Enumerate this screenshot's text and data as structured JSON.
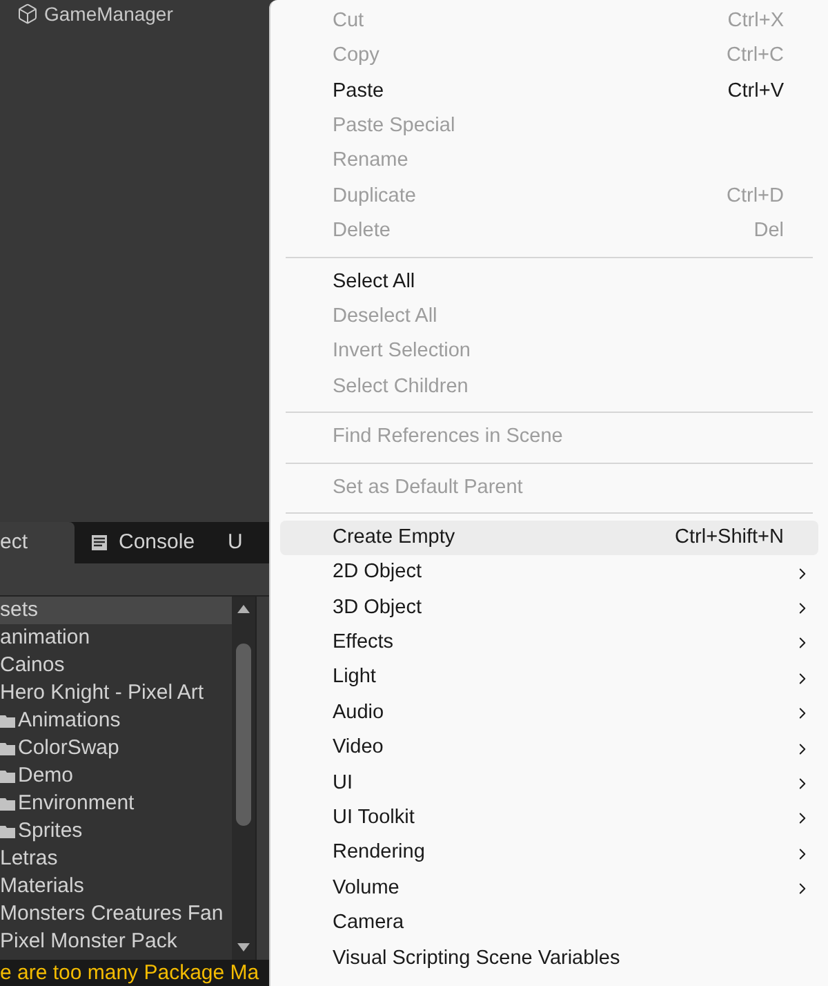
{
  "hierarchy": {
    "items": [
      {
        "label": "GameManager"
      }
    ]
  },
  "panel_tabs": [
    {
      "label": "ect",
      "selected": true,
      "kind": "plain"
    },
    {
      "label": "Console",
      "selected": false,
      "kind": "console"
    },
    {
      "label": "U",
      "selected": false,
      "kind": "plain"
    }
  ],
  "project_tree": [
    {
      "label": "sets",
      "selected": true,
      "children": [
        {
          "label": "animation",
          "selected": false
        },
        {
          "label": "Cainos",
          "selected": false
        },
        {
          "label": "Hero Knight - Pixel Art",
          "selected": false,
          "children": [
            {
              "label": "Animations",
              "selected": false
            },
            {
              "label": "ColorSwap",
              "selected": false
            },
            {
              "label": "Demo",
              "selected": false
            },
            {
              "label": "Environment",
              "selected": false
            },
            {
              "label": "Sprites",
              "selected": false
            }
          ]
        },
        {
          "label": "Letras",
          "selected": false
        },
        {
          "label": "Materials",
          "selected": false
        },
        {
          "label": "Monsters Creatures Fan",
          "selected": false
        },
        {
          "label": "Pixel Monster Pack",
          "selected": false
        }
      ]
    }
  ],
  "status_bar": {
    "message": "e are too many Package Ma"
  },
  "context_menu": [
    {
      "kind": "item",
      "label": "Cut",
      "shortcut": "Ctrl+X",
      "disabled": true,
      "selected": false,
      "submenu": false
    },
    {
      "kind": "item",
      "label": "Copy",
      "shortcut": "Ctrl+C",
      "disabled": true,
      "selected": false,
      "submenu": false
    },
    {
      "kind": "item",
      "label": "Paste",
      "shortcut": "Ctrl+V",
      "disabled": false,
      "selected": false,
      "submenu": false
    },
    {
      "kind": "item",
      "label": "Paste Special",
      "disabled": true,
      "selected": false,
      "submenu": false
    },
    {
      "kind": "item",
      "label": "Rename",
      "disabled": true,
      "selected": false,
      "submenu": false
    },
    {
      "kind": "item",
      "label": "Duplicate",
      "shortcut": "Ctrl+D",
      "disabled": true,
      "selected": false,
      "submenu": false
    },
    {
      "kind": "item",
      "label": "Delete",
      "shortcut": "Del",
      "disabled": true,
      "selected": false,
      "submenu": false
    },
    {
      "kind": "separator"
    },
    {
      "kind": "item",
      "label": "Select All",
      "disabled": false,
      "selected": false,
      "submenu": false
    },
    {
      "kind": "item",
      "label": "Deselect All",
      "disabled": true,
      "selected": false,
      "submenu": false
    },
    {
      "kind": "item",
      "label": "Invert Selection",
      "disabled": true,
      "selected": false,
      "submenu": false
    },
    {
      "kind": "item",
      "label": "Select Children",
      "disabled": true,
      "selected": false,
      "submenu": false
    },
    {
      "kind": "separator"
    },
    {
      "kind": "item",
      "label": "Find References in Scene",
      "disabled": true,
      "selected": false,
      "submenu": false
    },
    {
      "kind": "separator"
    },
    {
      "kind": "item",
      "label": "Set as Default Parent",
      "disabled": true,
      "selected": false,
      "submenu": false
    },
    {
      "kind": "separator"
    },
    {
      "kind": "item",
      "label": "Create Empty",
      "shortcut": "Ctrl+Shift+N",
      "disabled": false,
      "selected": true,
      "submenu": false
    },
    {
      "kind": "item",
      "label": "2D Object",
      "disabled": false,
      "selected": false,
      "submenu": true
    },
    {
      "kind": "item",
      "label": "3D Object",
      "disabled": false,
      "selected": false,
      "submenu": true
    },
    {
      "kind": "item",
      "label": "Effects",
      "disabled": false,
      "selected": false,
      "submenu": true
    },
    {
      "kind": "item",
      "label": "Light",
      "disabled": false,
      "selected": false,
      "submenu": true
    },
    {
      "kind": "item",
      "label": "Audio",
      "disabled": false,
      "selected": false,
      "submenu": true
    },
    {
      "kind": "item",
      "label": "Video",
      "disabled": false,
      "selected": false,
      "submenu": true
    },
    {
      "kind": "item",
      "label": "UI",
      "disabled": false,
      "selected": false,
      "submenu": true
    },
    {
      "kind": "item",
      "label": "UI Toolkit",
      "disabled": false,
      "selected": false,
      "submenu": true
    },
    {
      "kind": "item",
      "label": "Rendering",
      "disabled": false,
      "selected": false,
      "submenu": true
    },
    {
      "kind": "item",
      "label": "Volume",
      "disabled": false,
      "selected": false,
      "submenu": true
    },
    {
      "kind": "item",
      "label": "Camera",
      "disabled": false,
      "selected": false,
      "submenu": false
    },
    {
      "kind": "item",
      "label": "Visual Scripting Scene Variables",
      "disabled": false,
      "selected": false,
      "submenu": false
    }
  ]
}
